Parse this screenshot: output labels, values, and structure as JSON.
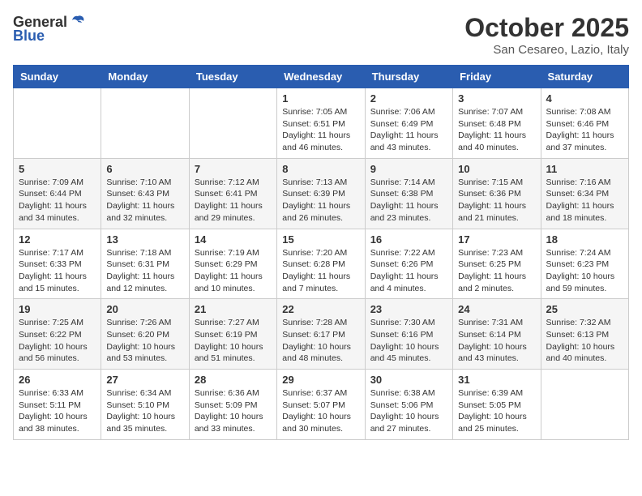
{
  "header": {
    "logo_general": "General",
    "logo_blue": "Blue",
    "month": "October 2025",
    "location": "San Cesareo, Lazio, Italy"
  },
  "days_of_week": [
    "Sunday",
    "Monday",
    "Tuesday",
    "Wednesday",
    "Thursday",
    "Friday",
    "Saturday"
  ],
  "weeks": [
    [
      {
        "day": "",
        "sunrise": "",
        "sunset": "",
        "daylight": ""
      },
      {
        "day": "",
        "sunrise": "",
        "sunset": "",
        "daylight": ""
      },
      {
        "day": "",
        "sunrise": "",
        "sunset": "",
        "daylight": ""
      },
      {
        "day": "1",
        "sunrise": "Sunrise: 7:05 AM",
        "sunset": "Sunset: 6:51 PM",
        "daylight": "Daylight: 11 hours and 46 minutes."
      },
      {
        "day": "2",
        "sunrise": "Sunrise: 7:06 AM",
        "sunset": "Sunset: 6:49 PM",
        "daylight": "Daylight: 11 hours and 43 minutes."
      },
      {
        "day": "3",
        "sunrise": "Sunrise: 7:07 AM",
        "sunset": "Sunset: 6:48 PM",
        "daylight": "Daylight: 11 hours and 40 minutes."
      },
      {
        "day": "4",
        "sunrise": "Sunrise: 7:08 AM",
        "sunset": "Sunset: 6:46 PM",
        "daylight": "Daylight: 11 hours and 37 minutes."
      }
    ],
    [
      {
        "day": "5",
        "sunrise": "Sunrise: 7:09 AM",
        "sunset": "Sunset: 6:44 PM",
        "daylight": "Daylight: 11 hours and 34 minutes."
      },
      {
        "day": "6",
        "sunrise": "Sunrise: 7:10 AM",
        "sunset": "Sunset: 6:43 PM",
        "daylight": "Daylight: 11 hours and 32 minutes."
      },
      {
        "day": "7",
        "sunrise": "Sunrise: 7:12 AM",
        "sunset": "Sunset: 6:41 PM",
        "daylight": "Daylight: 11 hours and 29 minutes."
      },
      {
        "day": "8",
        "sunrise": "Sunrise: 7:13 AM",
        "sunset": "Sunset: 6:39 PM",
        "daylight": "Daylight: 11 hours and 26 minutes."
      },
      {
        "day": "9",
        "sunrise": "Sunrise: 7:14 AM",
        "sunset": "Sunset: 6:38 PM",
        "daylight": "Daylight: 11 hours and 23 minutes."
      },
      {
        "day": "10",
        "sunrise": "Sunrise: 7:15 AM",
        "sunset": "Sunset: 6:36 PM",
        "daylight": "Daylight: 11 hours and 21 minutes."
      },
      {
        "day": "11",
        "sunrise": "Sunrise: 7:16 AM",
        "sunset": "Sunset: 6:34 PM",
        "daylight": "Daylight: 11 hours and 18 minutes."
      }
    ],
    [
      {
        "day": "12",
        "sunrise": "Sunrise: 7:17 AM",
        "sunset": "Sunset: 6:33 PM",
        "daylight": "Daylight: 11 hours and 15 minutes."
      },
      {
        "day": "13",
        "sunrise": "Sunrise: 7:18 AM",
        "sunset": "Sunset: 6:31 PM",
        "daylight": "Daylight: 11 hours and 12 minutes."
      },
      {
        "day": "14",
        "sunrise": "Sunrise: 7:19 AM",
        "sunset": "Sunset: 6:29 PM",
        "daylight": "Daylight: 11 hours and 10 minutes."
      },
      {
        "day": "15",
        "sunrise": "Sunrise: 7:20 AM",
        "sunset": "Sunset: 6:28 PM",
        "daylight": "Daylight: 11 hours and 7 minutes."
      },
      {
        "day": "16",
        "sunrise": "Sunrise: 7:22 AM",
        "sunset": "Sunset: 6:26 PM",
        "daylight": "Daylight: 11 hours and 4 minutes."
      },
      {
        "day": "17",
        "sunrise": "Sunrise: 7:23 AM",
        "sunset": "Sunset: 6:25 PM",
        "daylight": "Daylight: 11 hours and 2 minutes."
      },
      {
        "day": "18",
        "sunrise": "Sunrise: 7:24 AM",
        "sunset": "Sunset: 6:23 PM",
        "daylight": "Daylight: 10 hours and 59 minutes."
      }
    ],
    [
      {
        "day": "19",
        "sunrise": "Sunrise: 7:25 AM",
        "sunset": "Sunset: 6:22 PM",
        "daylight": "Daylight: 10 hours and 56 minutes."
      },
      {
        "day": "20",
        "sunrise": "Sunrise: 7:26 AM",
        "sunset": "Sunset: 6:20 PM",
        "daylight": "Daylight: 10 hours and 53 minutes."
      },
      {
        "day": "21",
        "sunrise": "Sunrise: 7:27 AM",
        "sunset": "Sunset: 6:19 PM",
        "daylight": "Daylight: 10 hours and 51 minutes."
      },
      {
        "day": "22",
        "sunrise": "Sunrise: 7:28 AM",
        "sunset": "Sunset: 6:17 PM",
        "daylight": "Daylight: 10 hours and 48 minutes."
      },
      {
        "day": "23",
        "sunrise": "Sunrise: 7:30 AM",
        "sunset": "Sunset: 6:16 PM",
        "daylight": "Daylight: 10 hours and 45 minutes."
      },
      {
        "day": "24",
        "sunrise": "Sunrise: 7:31 AM",
        "sunset": "Sunset: 6:14 PM",
        "daylight": "Daylight: 10 hours and 43 minutes."
      },
      {
        "day": "25",
        "sunrise": "Sunrise: 7:32 AM",
        "sunset": "Sunset: 6:13 PM",
        "daylight": "Daylight: 10 hours and 40 minutes."
      }
    ],
    [
      {
        "day": "26",
        "sunrise": "Sunrise: 6:33 AM",
        "sunset": "Sunset: 5:11 PM",
        "daylight": "Daylight: 10 hours and 38 minutes."
      },
      {
        "day": "27",
        "sunrise": "Sunrise: 6:34 AM",
        "sunset": "Sunset: 5:10 PM",
        "daylight": "Daylight: 10 hours and 35 minutes."
      },
      {
        "day": "28",
        "sunrise": "Sunrise: 6:36 AM",
        "sunset": "Sunset: 5:09 PM",
        "daylight": "Daylight: 10 hours and 33 minutes."
      },
      {
        "day": "29",
        "sunrise": "Sunrise: 6:37 AM",
        "sunset": "Sunset: 5:07 PM",
        "daylight": "Daylight: 10 hours and 30 minutes."
      },
      {
        "day": "30",
        "sunrise": "Sunrise: 6:38 AM",
        "sunset": "Sunset: 5:06 PM",
        "daylight": "Daylight: 10 hours and 27 minutes."
      },
      {
        "day": "31",
        "sunrise": "Sunrise: 6:39 AM",
        "sunset": "Sunset: 5:05 PM",
        "daylight": "Daylight: 10 hours and 25 minutes."
      },
      {
        "day": "",
        "sunrise": "",
        "sunset": "",
        "daylight": ""
      }
    ]
  ]
}
